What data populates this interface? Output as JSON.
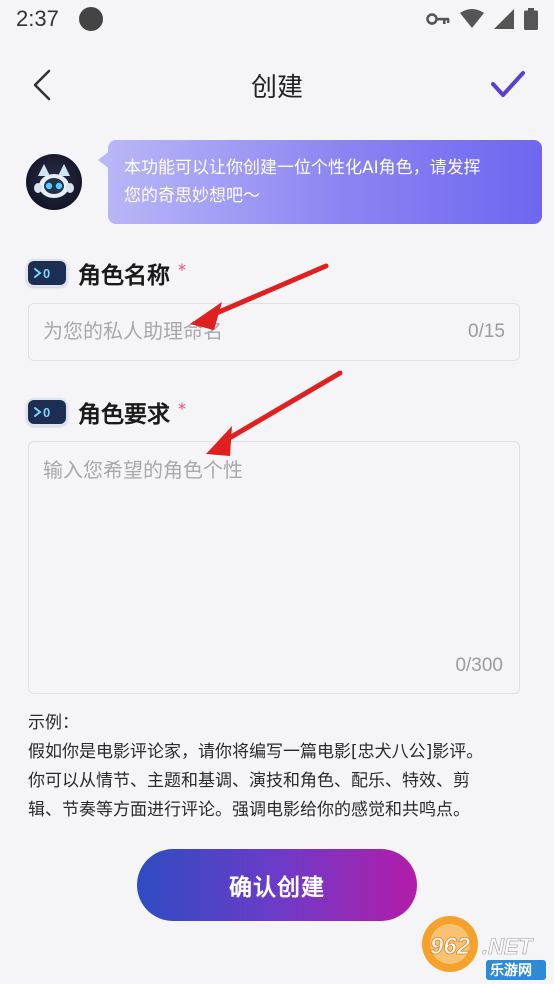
{
  "status_bar": {
    "time": "2:37"
  },
  "header": {
    "title": "创建"
  },
  "intro": {
    "line1": "本功能可以让你创建一位个性化AI角色，请发挥",
    "line2": "您的奇思妙想吧～"
  },
  "name_section": {
    "label": "角色名称",
    "required_mark": "*",
    "placeholder": "为您的私人助理命名",
    "counter": "0/15"
  },
  "requirement_section": {
    "label": "角色要求",
    "required_mark": "*",
    "placeholder": "输入您希望的角色个性",
    "counter": "0/300"
  },
  "example": {
    "heading": "示例：",
    "line1": "假如你是电影评论家，请你将编写一篇电影[忠犬八公]影评。",
    "line2": "你可以从情节、主题和基调、演技和角色、配乐、特效、剪",
    "line3": "辑、节奏等方面进行评论。强调电影给你的感觉和共鸣点。"
  },
  "confirm_button": {
    "label": "确认创建"
  },
  "label_icon": {
    "text": ">0"
  },
  "watermark": {
    "brand": "962.NET",
    "sub": "乐游网"
  },
  "colors": {
    "accent_purple": "#5b3fd1",
    "required_red": "#e84a6f",
    "arrow_red": "#e02020",
    "button_start": "#2f4cc2",
    "button_end": "#b21ca9"
  }
}
